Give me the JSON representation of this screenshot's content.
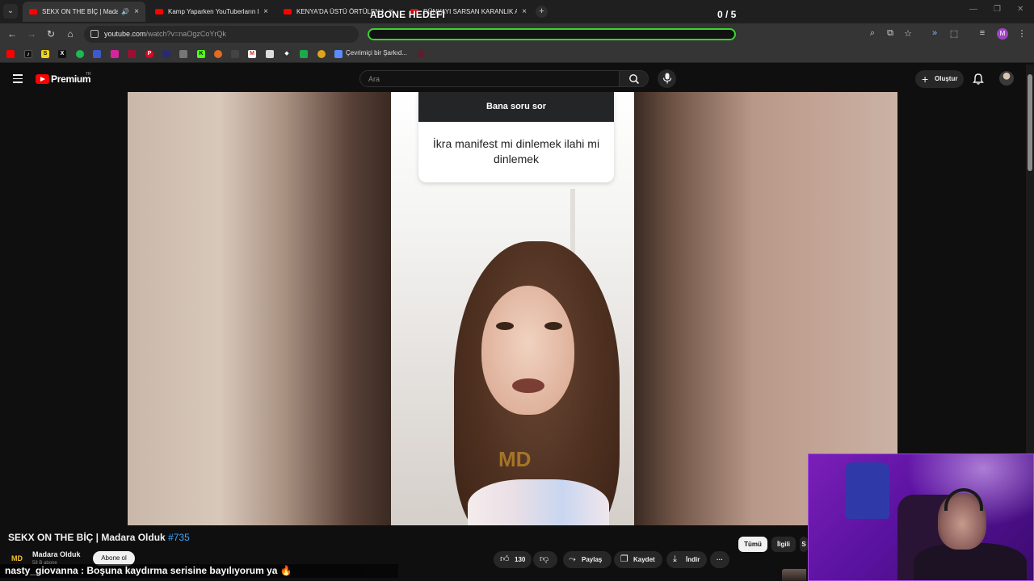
{
  "browser": {
    "tabs": [
      {
        "title": "SEKX ON THE BİÇ | Madara",
        "active": true,
        "audio": true
      },
      {
        "title": "Kamp Yaparken YouTuberların E",
        "active": false
      },
      {
        "title": "KENYA'DA ÜSTÜ ÖRTÜLEN KO",
        "active": false
      },
      {
        "title": "DÜNYAYI SARSAN KARANLIK A",
        "active": false
      }
    ],
    "url_host": "youtube.com",
    "url_path": "/watch?v=naOgzCoYrQk",
    "profile_initial": "M",
    "bookmark_label": "Çevrimiçi bir Şarkıd..."
  },
  "overlay": {
    "goal_title": "ABONE HEDEFİ",
    "goal_count": "0 / 5",
    "goal_progress": 0,
    "bar_color": "#39d62a"
  },
  "youtube": {
    "logo_text": "Premium",
    "logo_region": "TR",
    "search_placeholder": "Ara",
    "create_label": "Oluştur",
    "brand_red": "#ff0000"
  },
  "video": {
    "card_header": "Bana soru sor",
    "card_question": "İkra manifest mi dinlemek ilahi mi dinlemek",
    "watermark": "MD"
  },
  "meta": {
    "title": "SEKX ON THE BİÇ | Madara Olduk",
    "title_tag": "#735",
    "channel_name": "Madara Olduk",
    "channel_subs": "58 B abone",
    "channel_initials": "MD",
    "subscribe_label": "Abone ol",
    "likes": "130",
    "share_label": "Paylaş",
    "save_label": "Kaydet",
    "download_label": "İndir",
    "more_label": "···",
    "chips": [
      "Tümü",
      "İlgili",
      "S"
    ]
  },
  "chat": {
    "user": "nasty_giovanna",
    "message": " : Boşuna kaydırma serisine bayılıyorum ya ",
    "emoji": "🔥"
  },
  "icons": {
    "search": "search-icon",
    "mic": "mic-icon",
    "bell": "bell-icon",
    "like": "thumbs-up-icon",
    "dislike": "thumbs-down-icon",
    "share": "share-icon",
    "save": "bookmark-icon",
    "download": "download-icon"
  }
}
